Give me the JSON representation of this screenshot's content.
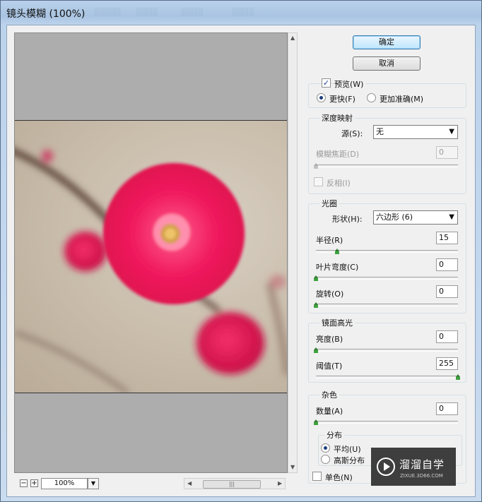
{
  "window": {
    "title": "镜头模糊 (100%)"
  },
  "buttons": {
    "ok": "确定",
    "cancel": "取消"
  },
  "preview_group": {
    "preview_label": "预览(W)",
    "preview_checked": true,
    "faster_label": "更快(F)",
    "accurate_label": "更加准确(M)",
    "selected": "faster"
  },
  "depth_map": {
    "legend": "深度映射",
    "source_label": "源(S):",
    "source_value": "无",
    "blur_focal_label": "模糊焦距(D)",
    "blur_focal_value": "0",
    "blur_focal_level": 0,
    "invert_label": "反相(I)",
    "invert_checked": false
  },
  "iris": {
    "legend": "光圈",
    "shape_label": "形状(H):",
    "shape_value": "六边形 (6)",
    "radius_label": "半径(R)",
    "radius_value": "15",
    "radius_level": 0.15,
    "curvature_label": "叶片弯度(C)",
    "curvature_value": "0",
    "curvature_level": 0,
    "rotation_label": "旋转(O)",
    "rotation_value": "0",
    "rotation_level": 0
  },
  "specular": {
    "legend": "镜面高光",
    "brightness_label": "亮度(B)",
    "brightness_value": "0",
    "brightness_level": 0,
    "threshold_label": "阈值(T)",
    "threshold_value": "255",
    "threshold_level": 1.0
  },
  "noise": {
    "legend": "杂色",
    "amount_label": "数量(A)",
    "amount_value": "0",
    "amount_level": 0,
    "distribution_legend": "分布",
    "uniform_label": "平均(U)",
    "gaussian_label": "高斯分布",
    "selected": "uniform",
    "mono_label": "单色(N)",
    "mono_checked": false
  },
  "statusbar": {
    "zoom_value": "100%",
    "zoom_out": "−",
    "zoom_in": "+"
  },
  "watermark": {
    "text": "溜溜自学",
    "sub": "ZIXUE.3D66.COM"
  }
}
